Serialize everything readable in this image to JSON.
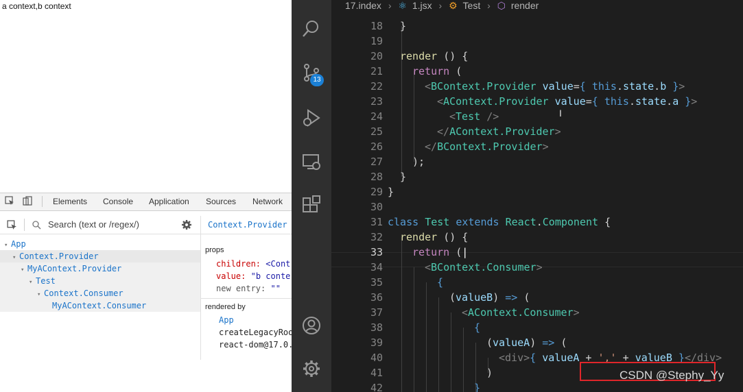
{
  "browser": {
    "page_output": "a context,b context",
    "devtools": {
      "tabs": [
        "Elements",
        "Console",
        "Application",
        "Sources",
        "Network"
      ],
      "search_placeholder": "Search (text or /regex/)",
      "tree": [
        {
          "label": "App",
          "expanded": true
        },
        {
          "label": "Context.Provider",
          "expanded": true,
          "selected": true
        },
        {
          "label": "MyAContext.Provider",
          "expanded": true
        },
        {
          "label": "Test",
          "expanded": true
        },
        {
          "label": "Context.Consumer",
          "expanded": true
        },
        {
          "label": "MyAContext.Consumer",
          "expanded": false
        }
      ],
      "inspector": {
        "component_name": "Context.Provider",
        "props_title": "props",
        "props": [
          {
            "key": "children:",
            "value": "<Cont"
          },
          {
            "key": "value:",
            "value": "\"b conte"
          },
          {
            "key": "new entry:",
            "value": "\"\""
          }
        ],
        "rendered_by_title": "rendered by",
        "rendered_by": [
          "App",
          "createLegacyRoo",
          "react-dom@17.0."
        ]
      }
    }
  },
  "vscode": {
    "breadcrumb": [
      "17.index",
      "1.jsx",
      "Test",
      "render"
    ],
    "scm_badge": "13",
    "activity_icons": [
      "search-icon",
      "source-control-icon",
      "run-debug-icon",
      "remote-explorer-icon",
      "extensions-icon",
      "account-icon",
      "settings-gear-icon"
    ],
    "lines": [
      {
        "n": "18",
        "text": "}"
      },
      {
        "n": "19",
        "text": ""
      },
      {
        "n": "20",
        "text": "render () {"
      },
      {
        "n": "21",
        "text": "return ("
      },
      {
        "n": "22",
        "text": "<BContext.Provider value={ this.state.b }>"
      },
      {
        "n": "23",
        "text": "<AContext.Provider value={ this.state.a }>"
      },
      {
        "n": "24",
        "text": "<Test />"
      },
      {
        "n": "25",
        "text": "</AContext.Provider>"
      },
      {
        "n": "26",
        "text": "</BContext.Provider>"
      },
      {
        "n": "27",
        "text": ");"
      },
      {
        "n": "28",
        "text": "}"
      },
      {
        "n": "29",
        "text": "}"
      },
      {
        "n": "30",
        "text": ""
      },
      {
        "n": "31",
        "text": "class Test extends React.Component {"
      },
      {
        "n": "32",
        "text": "render () {"
      },
      {
        "n": "33",
        "text": "return ("
      },
      {
        "n": "34",
        "text": "<BContext.Consumer>"
      },
      {
        "n": "35",
        "text": "{"
      },
      {
        "n": "36",
        "text": "(valueB) => ("
      },
      {
        "n": "37",
        "text": "<AContext.Consumer>"
      },
      {
        "n": "38",
        "text": "{"
      },
      {
        "n": "39",
        "text": "(valueA) => ("
      },
      {
        "n": "40",
        "text": "<div>{ valueA + ',' + valueB }</div>"
      },
      {
        "n": "41",
        "text": ")"
      },
      {
        "n": "42",
        "text": "}"
      }
    ],
    "watermark": "CSDN @Stephy_Yy",
    "colors": {
      "highlight_box": "#e0262a",
      "badge": "#1b80d6",
      "background": "#1e1e1e"
    }
  }
}
